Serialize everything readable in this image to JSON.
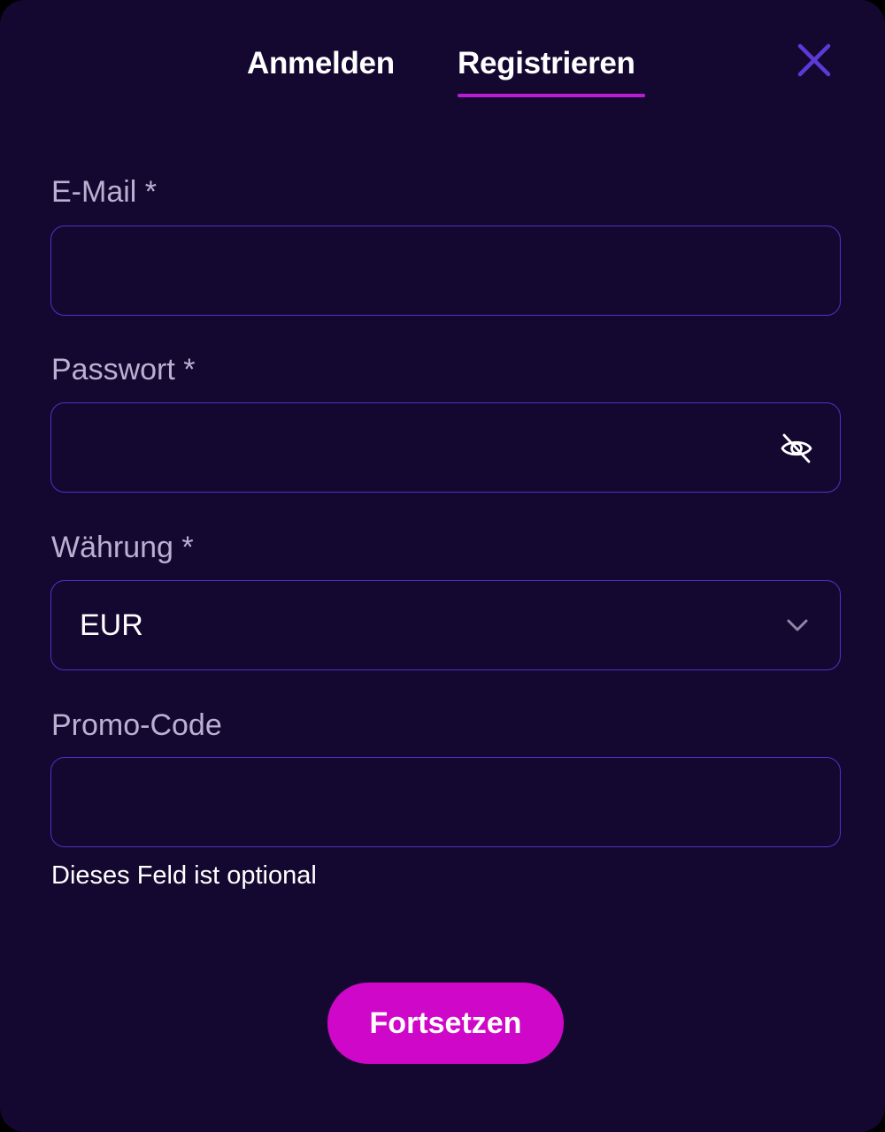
{
  "tabs": {
    "login_label": "Anmelden",
    "register_label": "Registrieren",
    "active": "register"
  },
  "close_icon": "close-icon",
  "form": {
    "email": {
      "label": "E-Mail *",
      "value": ""
    },
    "password": {
      "label": "Passwort *",
      "value": "",
      "toggle_icon": "eye-off-icon"
    },
    "currency": {
      "label": "Währung *",
      "selected": "EUR",
      "icon": "chevron-down-icon"
    },
    "promo": {
      "label": "Promo-Code",
      "value": "",
      "hint": "Dieses Feld ist optional"
    },
    "submit_label": "Fortsetzen"
  },
  "colors": {
    "background": "#150830",
    "field_border": "#4d32c8",
    "label": "#bab0d2",
    "accent": "#cf07c8",
    "tab_underline": "#b81ed0",
    "close_icon": "#5b3ad8"
  }
}
